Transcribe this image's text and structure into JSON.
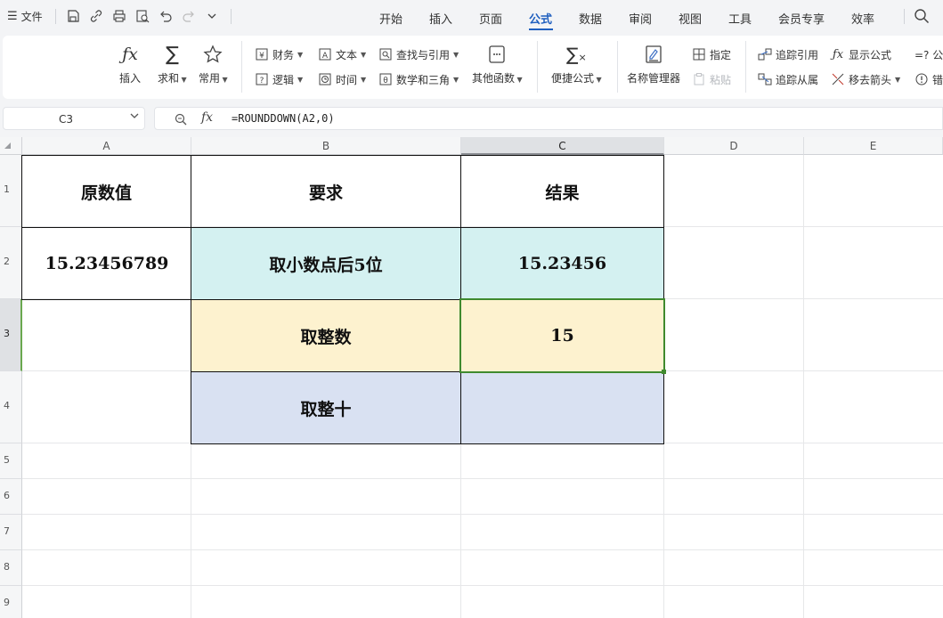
{
  "menubar": {
    "file_label": "文件",
    "tabs": [
      "开始",
      "插入",
      "页面",
      "公式",
      "数据",
      "审阅",
      "视图",
      "工具",
      "会员专享",
      "效率"
    ],
    "active_tab": "公式"
  },
  "ribbon": {
    "insert_label": "插入",
    "sum_label": "求和",
    "common_label": "常用",
    "finance_label": "财务",
    "text_label": "文本",
    "lookup_label": "查找与引用",
    "logic_label": "逻辑",
    "time_label": "时间",
    "math_label": "数学和三角",
    "other_label": "其他函数",
    "quick_label": "便捷公式",
    "name_mgr_label": "名称管理器",
    "assign_label": "指定",
    "paste_label": "粘贴",
    "trace_prec_label": "追踪引用",
    "trace_dep_label": "追踪从属",
    "show_formula_label": "显示公式",
    "remove_arrows_label": "移去箭头",
    "truncated_1": "=? 公",
    "truncated_2": "错"
  },
  "formula_bar": {
    "cell_ref": "C3",
    "fx": "fx",
    "formula": "=ROUNDDOWN(A2,0)"
  },
  "sheet": {
    "columns": [
      "A",
      "B",
      "C",
      "D",
      "E"
    ],
    "rows": [
      "1",
      "2",
      "3",
      "4",
      "5",
      "6",
      "7",
      "8",
      "9"
    ],
    "a1": "原数值",
    "b1": "要求",
    "c1": "结果",
    "a2": "15.23456789",
    "b2": "取小数点后5位",
    "c2": "15.23456",
    "a3": "",
    "b3": "取整数",
    "c3": "15",
    "b4": "取整十",
    "c4": ""
  },
  "colors": {
    "accent": "#1f5fbf",
    "selection": "#3f8a2e",
    "row2_fill": "#d4f1f1",
    "row3_fill": "#fdf2cf",
    "row4_fill": "#d9e1f2"
  }
}
